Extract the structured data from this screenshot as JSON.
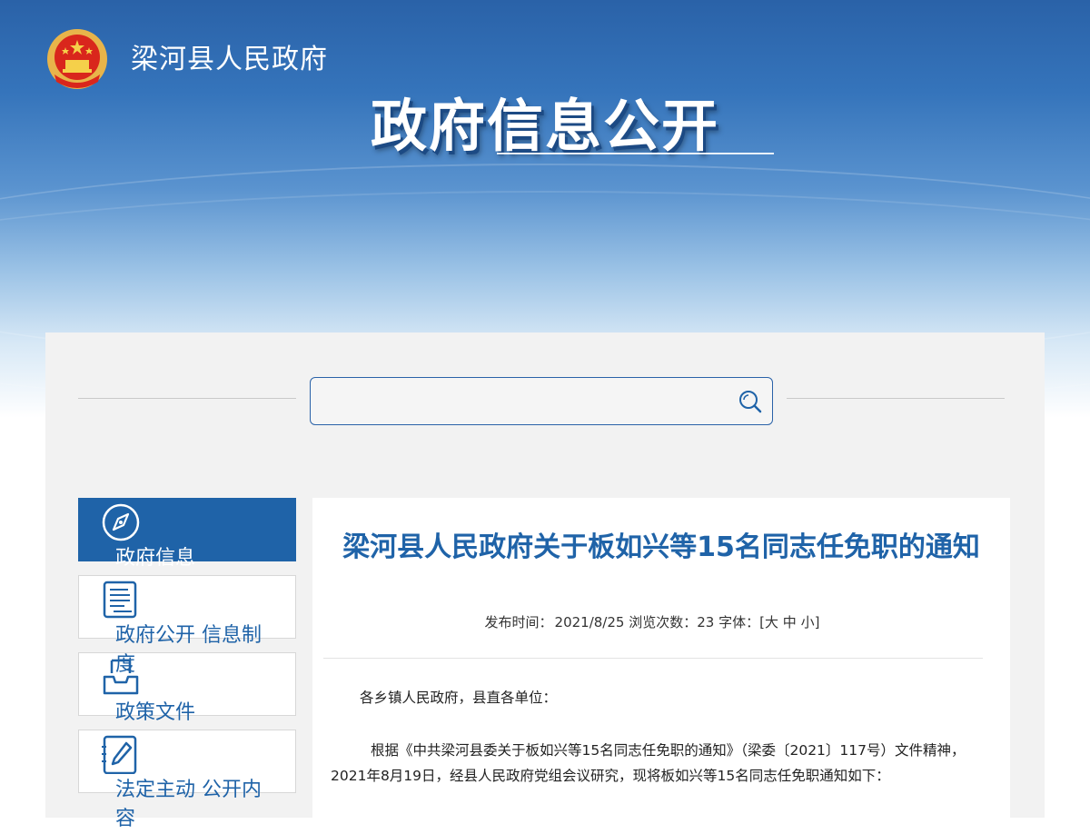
{
  "header": {
    "site_name": "梁河县人民政府",
    "main_title": "政府信息公开"
  },
  "search": {
    "value": "",
    "placeholder": ""
  },
  "sidebar": {
    "items": [
      {
        "label": "政府信息",
        "icon": "compass-icon",
        "active": true
      },
      {
        "label": "政府公开 信息制度",
        "icon": "document-list-icon",
        "active": false
      },
      {
        "label": "政策文件",
        "icon": "inbox-tray-icon",
        "active": false
      },
      {
        "label": "法定主动 公开内容",
        "icon": "edit-pen-icon",
        "active": false
      }
    ]
  },
  "article": {
    "title": "梁河县人民政府关于板如兴等15名同志任免职的通知",
    "meta": {
      "publish_label": "发布时间：",
      "publish_date": "2021/8/25",
      "views_label": "浏览次数：",
      "views": "23",
      "font_label": "字体：",
      "font_open": "[",
      "font_large": "大",
      "font_medium": "中",
      "font_small": "小",
      "font_close": "]"
    },
    "salutation": "各乡镇人民政府，县直各单位：",
    "body_1": "根据《中共梁河县委关于板如兴等15名同志任免职的通知》（梁委〔2021〕117号）文件精神，2021年8月19日，经县人民政府党组会议研究，现将板如兴等15名同志任免职通知如下："
  },
  "colors": {
    "brand_blue": "#1f63a8",
    "banner_top": "#2a62a8",
    "panel_bg": "#f2f2f2"
  }
}
